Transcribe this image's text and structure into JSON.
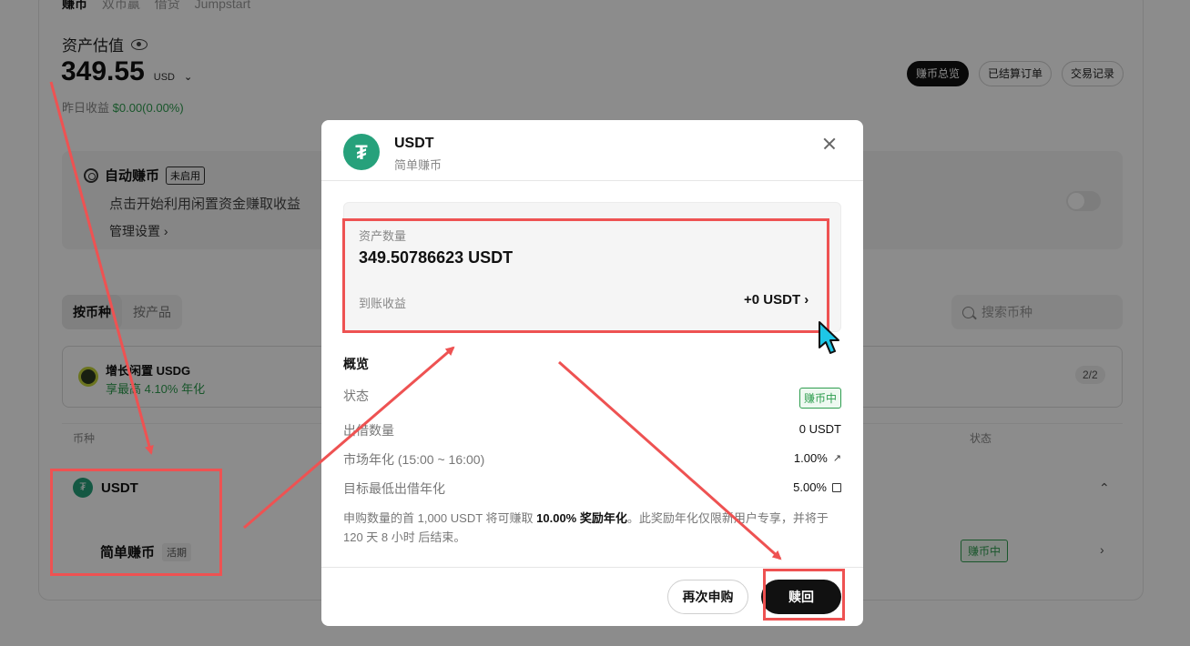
{
  "page": {
    "top_tabs": [
      "赚币",
      "双币赢",
      "借贷",
      "Jumpstart"
    ],
    "estimate_title": "资产估值",
    "balance": "349.55",
    "currency": "USD",
    "yesterday_label": "昨日收益",
    "yesterday_value": "$0.00(0.00%)",
    "buttons": {
      "overview": "赚币总览",
      "settled": "已结算订单",
      "history": "交易记录"
    },
    "auto": {
      "title": "自动赚币",
      "badge": "未启用",
      "desc": "点击开始利用闲置资金赚取收益",
      "manage": "管理设置 ›"
    },
    "segments": {
      "by_coin": "按币种",
      "by_product": "按产品"
    },
    "search_placeholder": "搜索币种",
    "promo": {
      "title": "增长闲置 USDG",
      "subtitle": "享最高 4.10% 年化",
      "count": "2/2"
    },
    "table_headers": {
      "coin": "币种",
      "status": "状态"
    },
    "asset_row": {
      "name": "USDT",
      "product": "简单赚币",
      "tag": "活期",
      "status": "赚币中"
    }
  },
  "modal": {
    "title": "USDT",
    "subtitle": "简单赚币",
    "asset_label": "资产数量",
    "asset_amount": "349.50786623 USDT",
    "income_label": "到账收益",
    "income_value": "+0 USDT ›",
    "overview_title": "概览",
    "rows": [
      {
        "k": "状态",
        "v": "赚币中"
      },
      {
        "k": "出借数量",
        "v": "0 USDT"
      },
      {
        "k": "市场年化 (15:00 ~ 16:00)",
        "v": "1.00%"
      },
      {
        "k": "目标最低出借年化",
        "v": "5.00%"
      }
    ],
    "note_pre": "申购数量的首 1,000 USDT 将可赚取 ",
    "note_bold": "10.00% 奖励年化",
    "note_post": "。此奖励年化仅限新用户专享，并将于 120 天 8 小时 后结束。",
    "btn_again": "再次申购",
    "btn_redeem": "赎回"
  },
  "colors": {
    "green": "#2e9d4f",
    "tether": "#26a17b",
    "annotation_red": "#ee5252",
    "dark": "#111111"
  },
  "icons": [
    "eye-icon",
    "coin-ring-icon",
    "search-icon",
    "close-icon",
    "trend-icon",
    "edit-icon",
    "cursor-icon"
  ]
}
